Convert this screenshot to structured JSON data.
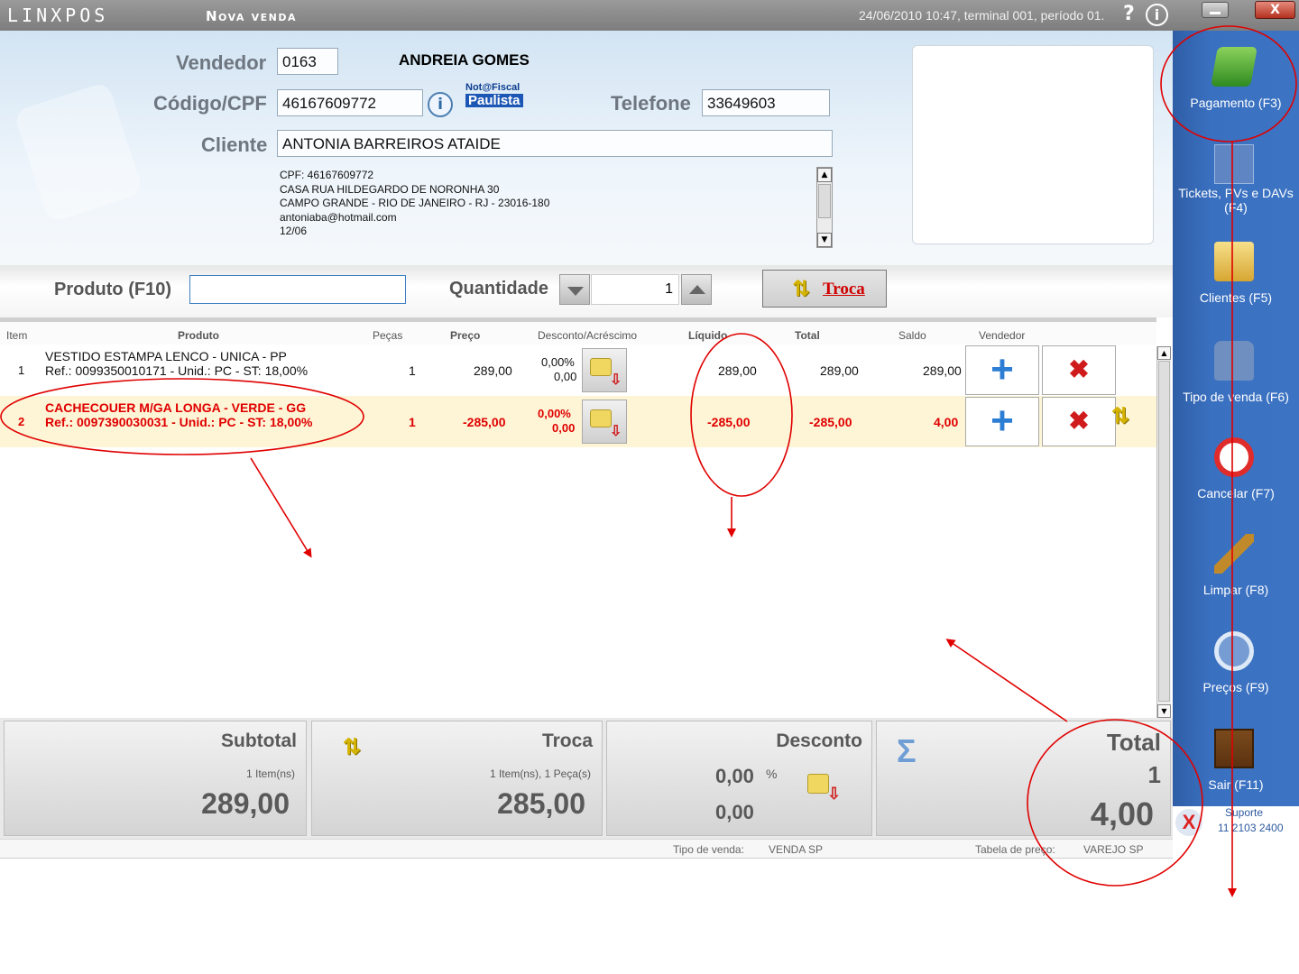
{
  "titlebar": {
    "app_name": "LINXPOS",
    "screen_title": "Nova venda",
    "status": "24/06/2010 10:47, terminal 001, período 01.",
    "help": "?",
    "info": "i",
    "close": "X"
  },
  "header": {
    "seller_label": "Vendedor",
    "seller_code": "0163",
    "seller_name": "ANDREIA GOMES",
    "cpf_label": "Código/CPF",
    "cpf_value": "46167609772",
    "info_button": "i",
    "nfp_top": "Not@Fiscal",
    "nfp_bottom": "Paulista",
    "phone_label": "Telefone",
    "phone_value": "33649603",
    "client_label": "Cliente",
    "client_value": "ANTONIA BARREIROS ATAIDE",
    "client_details": [
      "CPF: 46167609772",
      "CASA RUA HILDEGARDO DE NORONHA 30",
      "CAMPO GRANDE - RIO DE JANEIRO - RJ - 23016-180",
      "antoniaba@hotmail.com",
      "12/06"
    ]
  },
  "product_bar": {
    "product_label": "Produto (F10)",
    "product_value": "",
    "qty_label": "Quantidade",
    "qty_value": "1",
    "troca_label": "Troca"
  },
  "grid": {
    "headers": {
      "item": "Item",
      "produto": "Produto",
      "pecas": "Peças",
      "preco": "Preço",
      "desconto": "Desconto/Acréscimo",
      "liquido": "Líquido",
      "total": "Total",
      "saldo": "Saldo",
      "vendedor": "Vendedor"
    },
    "rows": [
      {
        "item": "1",
        "desc": "VESTIDO ESTAMPA LENCO - UNICA - PP",
        "ref": "Ref.: 0099350010171 - Unid.: PC - ST: 18,00%",
        "pecas": "1",
        "preco": "289,00",
        "desc_pct": "0,00%",
        "desc_val": "0,00",
        "liquido": "289,00",
        "total": "289,00",
        "saldo": "289,00",
        "plus": "+",
        "delete": "✖"
      },
      {
        "item": "2",
        "desc": "CACHECOUER M/GA LONGA - VERDE - GG",
        "ref": "Ref.: 0097390030031 - Unid.: PC - ST: 18,00%",
        "pecas": "1",
        "preco": "-285,00",
        "desc_pct": "0,00%",
        "desc_val": "0,00",
        "liquido": "-285,00",
        "total": "-285,00",
        "saldo": "4,00",
        "plus": "+",
        "delete": "✖"
      }
    ]
  },
  "totals": {
    "subtotal_label": "Subtotal",
    "subtotal_items": "1 Item(ns)",
    "subtotal_value": "289,00",
    "troca_label": "Troca",
    "troca_items": "1 Item(ns), 1 Peça(s)",
    "troca_value": "285,00",
    "desconto_label": "Desconto",
    "desconto_pct": "0,00",
    "pct_sign": "%",
    "desconto_value": "0,00",
    "sigma": "Σ",
    "total_label": "Total",
    "total_count": "1",
    "total_value": "4,00"
  },
  "status_bar": {
    "tipo_label": "Tipo de venda:",
    "tipo_value": "VENDA SP",
    "tabela_label": "Tabela de preço:",
    "tabela_value": "VAREJO SP"
  },
  "sidebar": {
    "items": [
      {
        "label": "Pagamento (F3)",
        "icon": "payment-icon"
      },
      {
        "label": "Tickets, PVs e DAVs (F4)",
        "icon": "tickets-icon"
      },
      {
        "label": "Clientes (F5)",
        "icon": "clients-icon"
      },
      {
        "label": "Tipo de venda (F6)",
        "icon": "sale-type-icon"
      },
      {
        "label": "Cancelar (F7)",
        "icon": "cancel-icon"
      },
      {
        "label": "Limpar (F8)",
        "icon": "broom-icon"
      },
      {
        "label": "Preços (F9)",
        "icon": "price-search-icon"
      },
      {
        "label": "Sair (F11)",
        "icon": "exit-door-icon"
      }
    ],
    "support_label": "Suporte",
    "support_phone": "11 2103 2400"
  },
  "colors": {
    "sidebar": "#3a70c0",
    "accent_red": "#e00000",
    "annotation": "#e00000"
  }
}
